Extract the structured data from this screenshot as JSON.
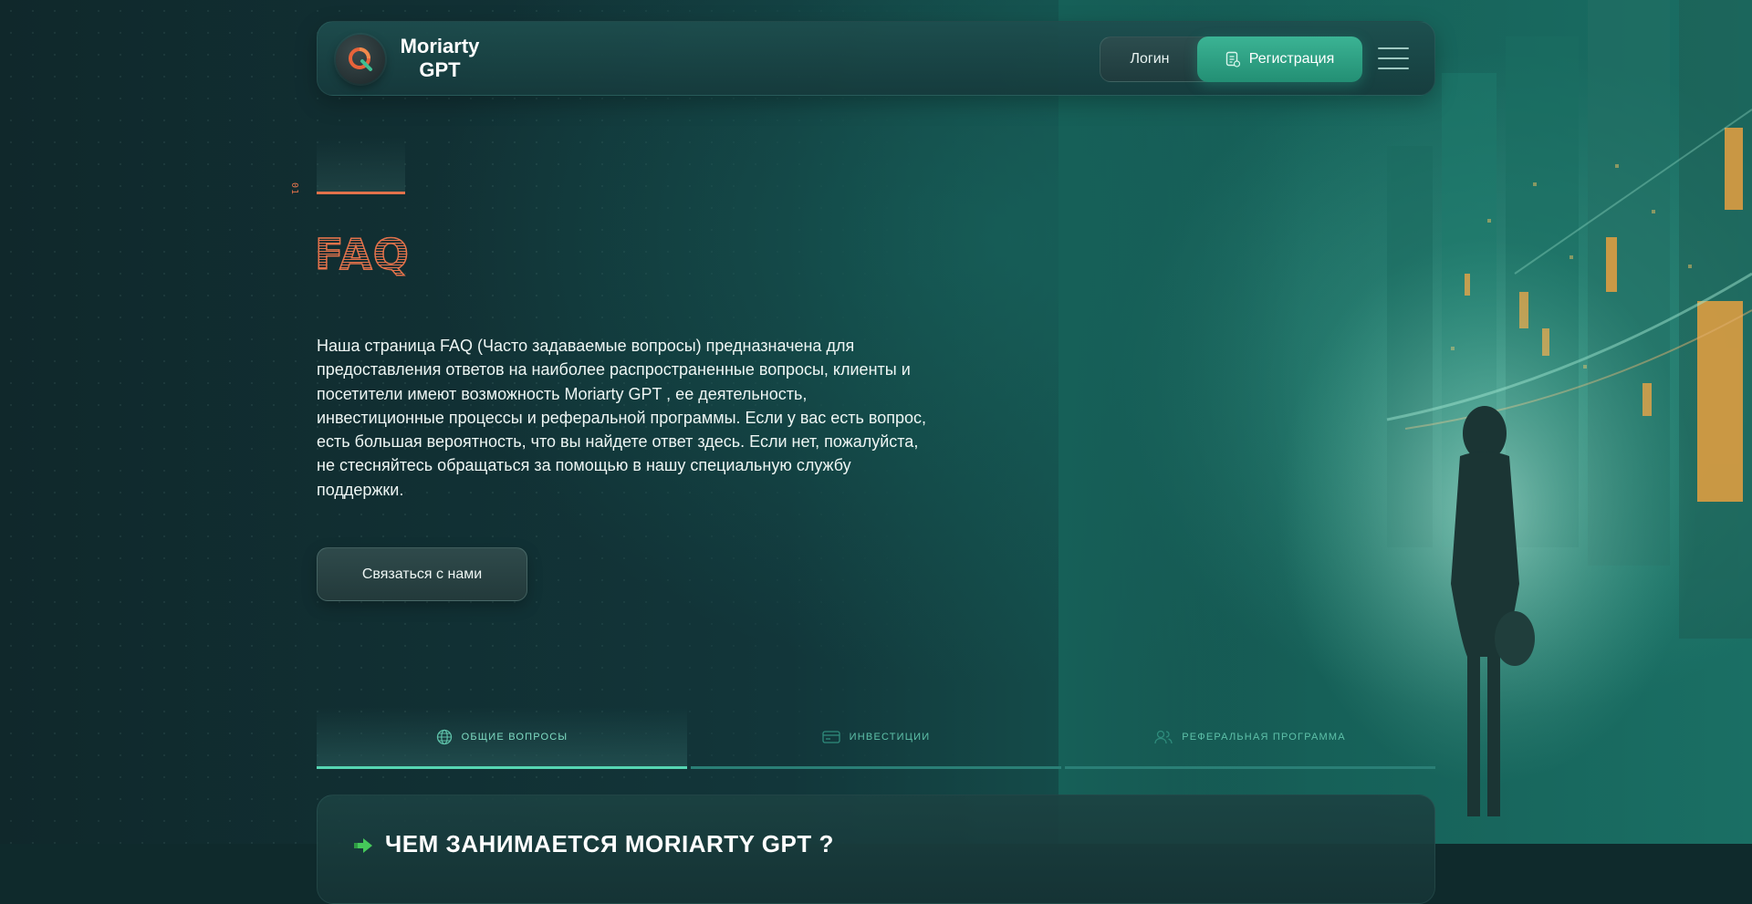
{
  "header": {
    "brand": "Moriarty GPT",
    "brand_line1": "Moriarty",
    "brand_line2": "GPT",
    "login_label": "Логин",
    "register_label": "Регистрация",
    "logo_icon": "moriarty-q-logo",
    "menu_icon": "hamburger-menu-icon"
  },
  "hero": {
    "section_index": "01",
    "title": "FAQ",
    "intro": "Наша страница FAQ (Часто задаваемые вопросы) предназначена для предоставления ответов на наиболее распространенные вопросы, клиенты и посетители имеют возможность Moriarty GPT , ее деятельность, инвестиционные процессы и реферальной программы. Если у вас есть вопрос, есть большая вероятность, что вы найдете ответ здесь. Если нет, пожалуйста, не стесняйтесь обращаться за помощью в нашу специальную службу поддержки.",
    "contact_label": "Связаться с нами"
  },
  "tabs": [
    {
      "label": "ОБЩИЕ ВОПРОСЫ",
      "icon": "globe-icon",
      "active": true
    },
    {
      "label": "ИНВЕСТИЦИИ",
      "icon": "card-icon",
      "active": false
    },
    {
      "label": "РЕФЕРАЛЬНАЯ ПРОГРАММА",
      "icon": "users-icon",
      "active": false
    }
  ],
  "question": {
    "title": "ЧЕМ ЗАНИМАЕТСЯ MORIARTY GPT ?",
    "icon": "green-arrow-icon"
  },
  "colors": {
    "accent_orange": "#e3724b",
    "accent_teal": "#56d6b3",
    "register_green": "#2fa384",
    "background": "#0f2a2c"
  }
}
